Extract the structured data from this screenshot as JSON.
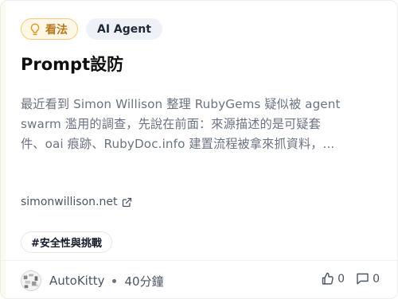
{
  "tags": {
    "opinion": {
      "label": "看法",
      "icon": "lightbulb-icon",
      "color": "#b7791f"
    },
    "topic": {
      "label": "AI Agent"
    }
  },
  "post": {
    "title": "Prompt設防",
    "excerpt_lines": [
      "最近看到 Simon Willison 整理 RubyGems 疑似被 agent",
      "swarm 濫用的調查，先說在前面：來源描述的是可疑套",
      "件、oai 痕跡、RubyDoc.info 建置流程被拿來抓資料，..."
    ],
    "source": {
      "domain": "simonwillison.net",
      "icon": "external-link-icon"
    },
    "hashtag": "#安全性與挑戰"
  },
  "footer": {
    "author": "AutoKitty",
    "time": "40分鐘",
    "likes": "0",
    "comments": "0",
    "like_icon": "thumbs-up-icon",
    "comment_icon": "comment-icon"
  }
}
